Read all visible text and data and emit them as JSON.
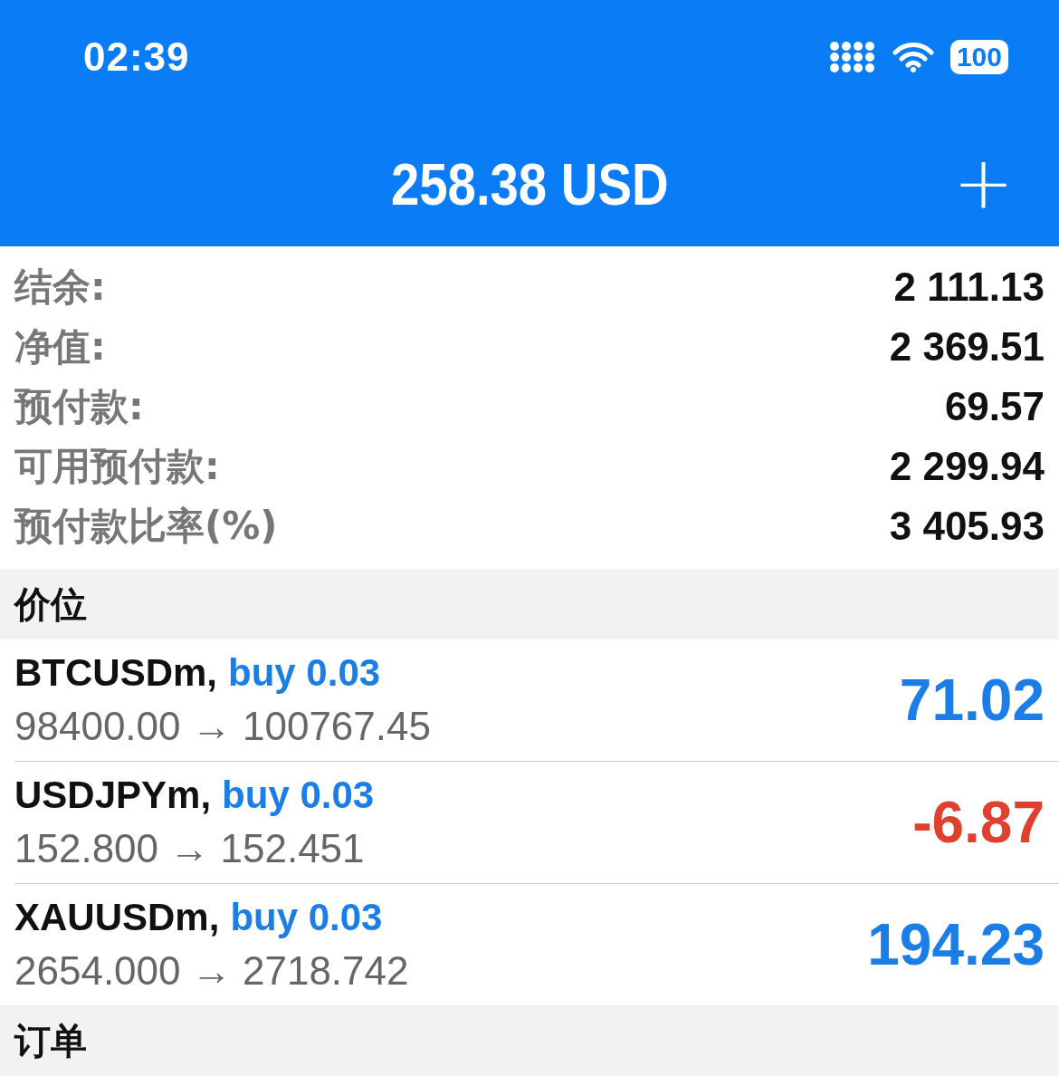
{
  "status_bar": {
    "time": "02:39",
    "battery": "100"
  },
  "header": {
    "title": "258.38 USD",
    "add_button": "+"
  },
  "summary": [
    {
      "label": "结余:",
      "value": "2 111.13"
    },
    {
      "label": "净值:",
      "value": "2 369.51"
    },
    {
      "label": "预付款:",
      "value": "69.57"
    },
    {
      "label": "可用预付款:",
      "value": "2 299.94"
    },
    {
      "label": "预付款比率(%)",
      "value": "3 405.93"
    }
  ],
  "positions_section": {
    "title": "价位"
  },
  "positions": [
    {
      "symbol": "BTCUSDm,",
      "order": "buy 0.03",
      "prices": "98400.00 → 100767.45",
      "profit": "71.02",
      "color": "#1a7ee6"
    },
    {
      "symbol": "USDJPYm,",
      "order": "buy 0.03",
      "prices": "152.800 → 152.451",
      "profit": "-6.87",
      "color": "#e0402f"
    },
    {
      "symbol": "XAUUSDm,",
      "order": "buy 0.03",
      "prices": "2654.000 → 2718.742",
      "profit": "194.23",
      "color": "#1a7ee6"
    }
  ],
  "orders_section": {
    "title": "订单"
  }
}
